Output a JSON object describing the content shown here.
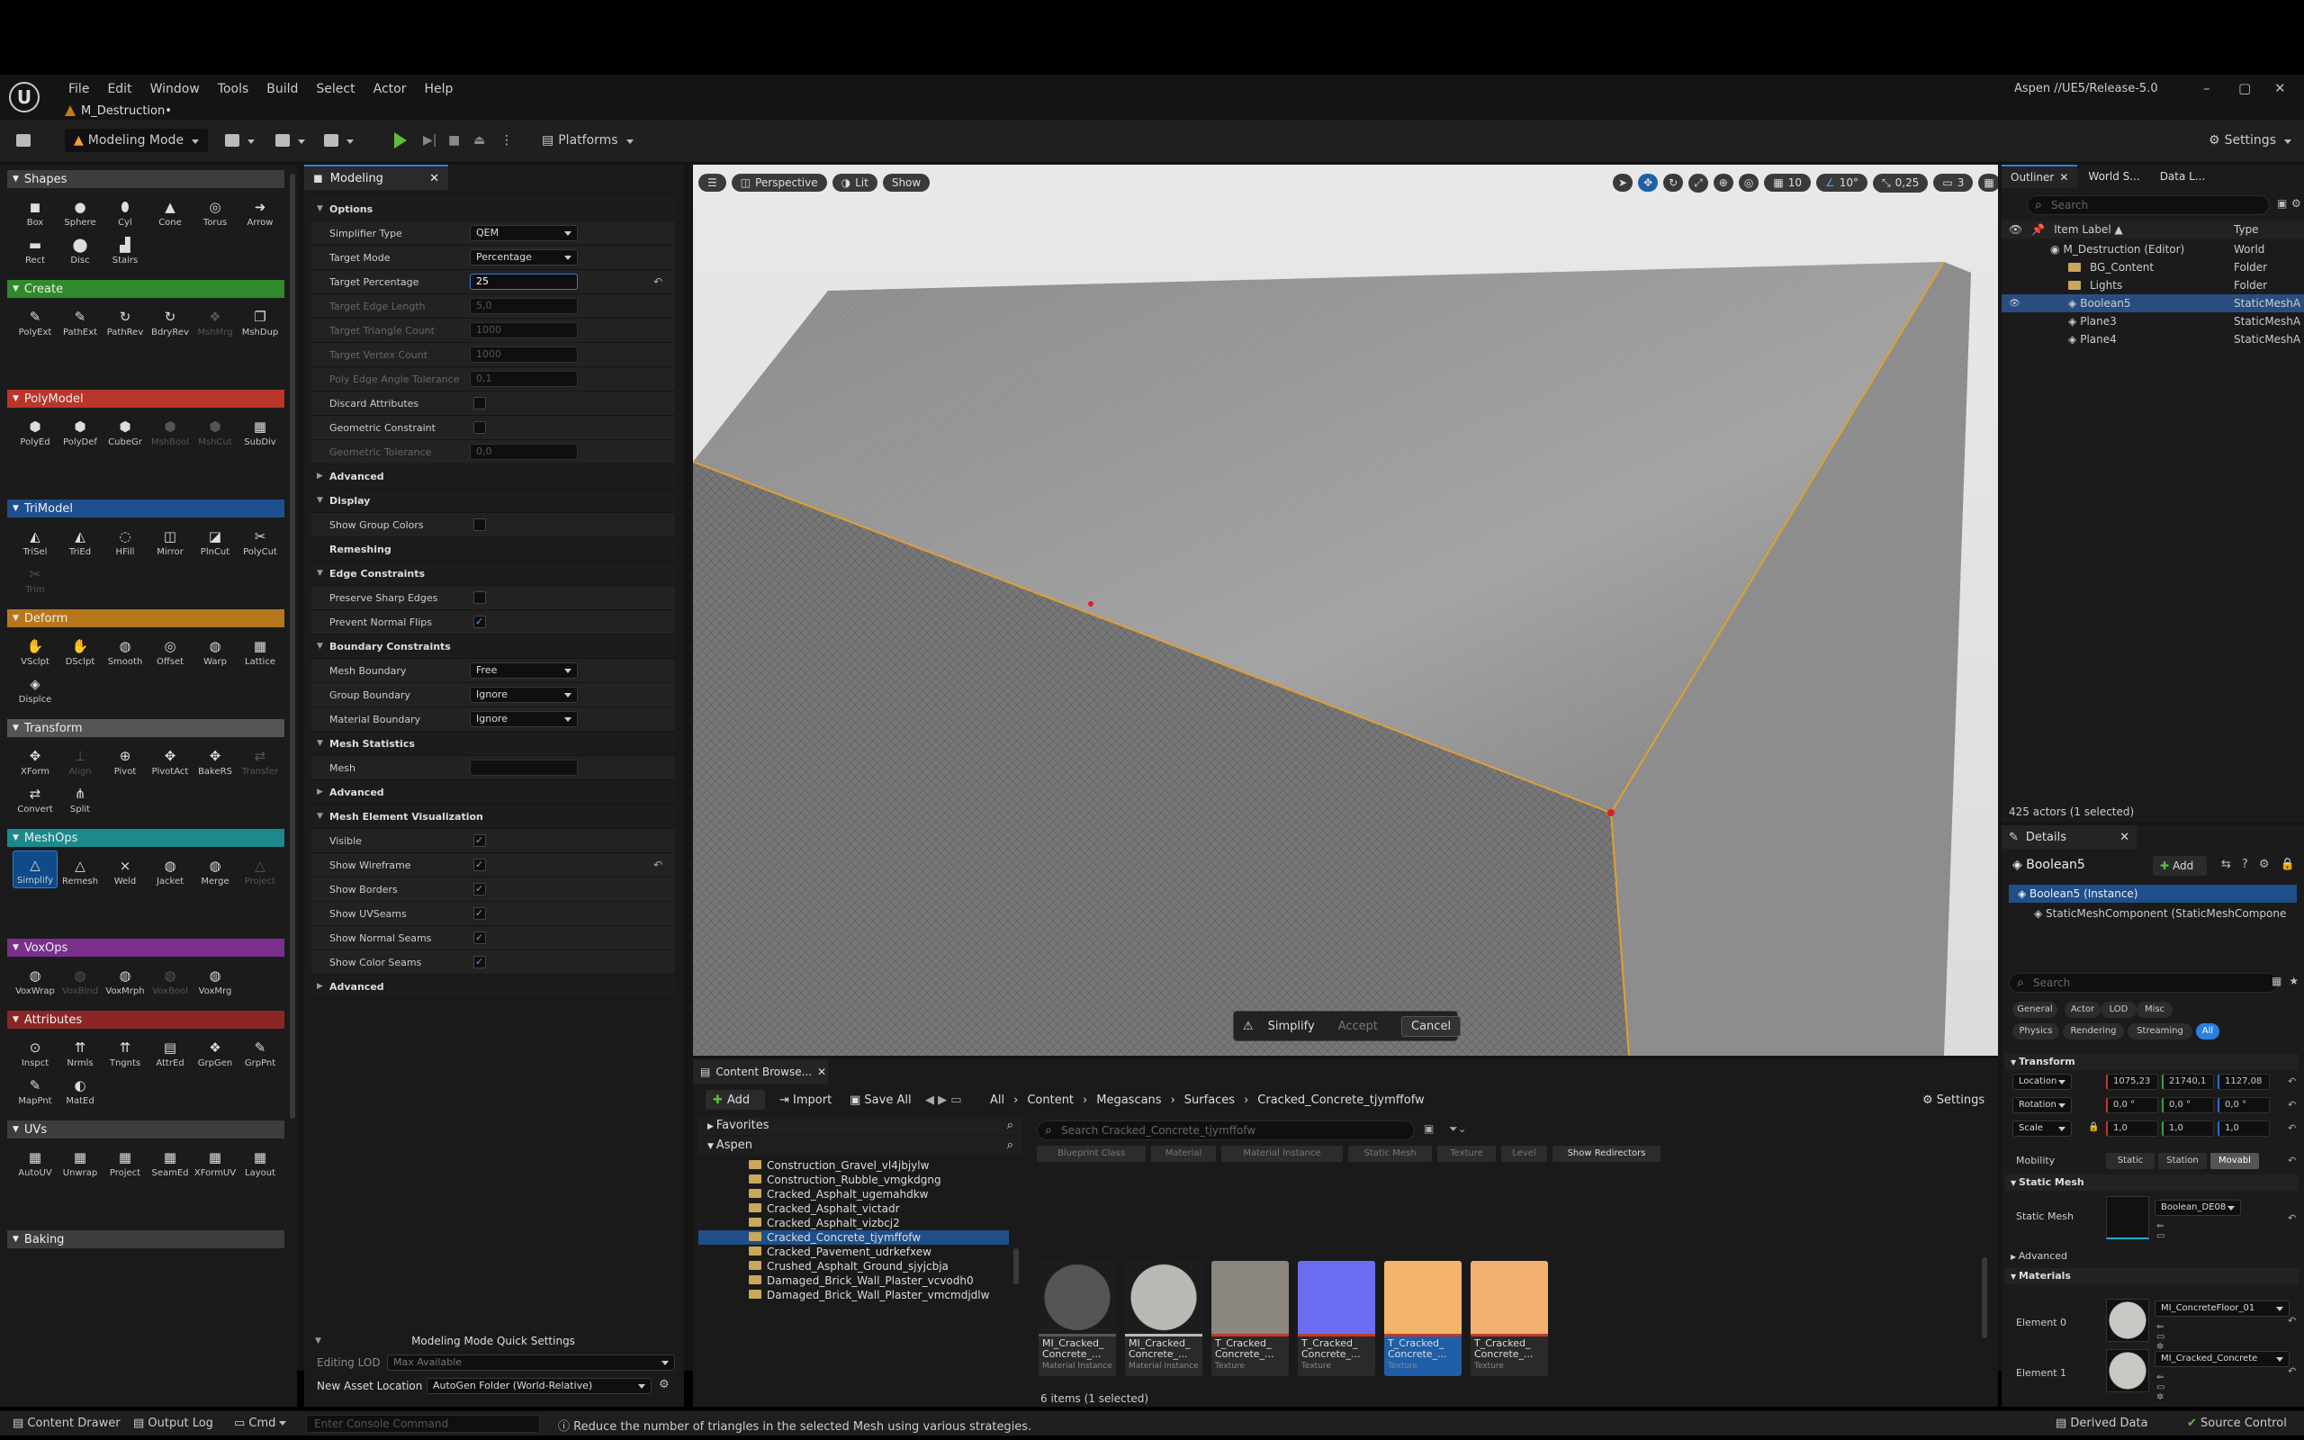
{
  "menu": [
    "File",
    "Edit",
    "Window",
    "Tools",
    "Build",
    "Select",
    "Actor",
    "Help"
  ],
  "doc_tab": "M_Destruction•",
  "project": "Aspen //UE5/Release-5.0",
  "toolbar": {
    "mode": "Modeling Mode",
    "platforms": "Platforms",
    "settings": "Settings"
  },
  "palette": {
    "sections": [
      {
        "name": "Shapes",
        "color": "#3d3d3d",
        "tools": [
          {
            "l": "Box",
            "g": "◼"
          },
          {
            "l": "Sphere",
            "g": "●"
          },
          {
            "l": "Cyl",
            "g": "⬮"
          },
          {
            "l": "Cone",
            "g": "▲"
          },
          {
            "l": "Torus",
            "g": "◎"
          },
          {
            "l": "Arrow",
            "g": "➜"
          },
          {
            "l": "Rect",
            "g": "▬"
          },
          {
            "l": "Disc",
            "g": "⬤"
          },
          {
            "l": "Stairs",
            "g": "▟"
          }
        ]
      },
      {
        "name": "Create",
        "color": "#2f8a2c",
        "tools": [
          {
            "l": "PolyExt",
            "g": "✎"
          },
          {
            "l": "PathExt",
            "g": "✎"
          },
          {
            "l": "PathRev",
            "g": "↻"
          },
          {
            "l": "BdryRev",
            "g": "↻"
          },
          {
            "l": "MshMrg",
            "g": "❖",
            "d": true
          },
          {
            "l": "MshDup",
            "g": "❐"
          }
        ]
      },
      {
        "name": "PolyModel",
        "color": "#b8362a",
        "tools": [
          {
            "l": "PolyEd",
            "g": "⬢"
          },
          {
            "l": "PolyDef",
            "g": "⬢"
          },
          {
            "l": "CubeGr",
            "g": "⬢"
          },
          {
            "l": "MshBool",
            "g": "⬢",
            "d": true
          },
          {
            "l": "MshCut",
            "g": "⬢",
            "d": true
          },
          {
            "l": "SubDiv",
            "g": "▦"
          }
        ]
      },
      {
        "name": "TriModel",
        "color": "#1e4f8f",
        "tools": [
          {
            "l": "TriSel",
            "g": "◭"
          },
          {
            "l": "TriEd",
            "g": "◭"
          },
          {
            "l": "HFill",
            "g": "◌"
          },
          {
            "l": "Mirror",
            "g": "◫"
          },
          {
            "l": "PlnCut",
            "g": "◪"
          },
          {
            "l": "PolyCut",
            "g": "✂"
          },
          {
            "l": "Trim",
            "g": "✂",
            "d": true
          }
        ]
      },
      {
        "name": "Deform",
        "color": "#b6771c",
        "tools": [
          {
            "l": "VSclpt",
            "g": "✋"
          },
          {
            "l": "DSclpt",
            "g": "✋"
          },
          {
            "l": "Smooth",
            "g": "◍"
          },
          {
            "l": "Offset",
            "g": "◎"
          },
          {
            "l": "Warp",
            "g": "◍"
          },
          {
            "l": "Lattice",
            "g": "▦"
          },
          {
            "l": "Displce",
            "g": "◈"
          }
        ]
      },
      {
        "name": "Transform",
        "color": "#555555",
        "tools": [
          {
            "l": "XForm",
            "g": "✥"
          },
          {
            "l": "Align",
            "g": "⊥",
            "d": true
          },
          {
            "l": "Pivot",
            "g": "⊕"
          },
          {
            "l": "PivotAct",
            "g": "✥"
          },
          {
            "l": "BakeRS",
            "g": "✥"
          },
          {
            "l": "Transfer",
            "g": "⇄",
            "d": true
          },
          {
            "l": "Convert",
            "g": "⇄"
          },
          {
            "l": "Split",
            "g": "⋔"
          }
        ]
      },
      {
        "name": "MeshOps",
        "color": "#1c8a8c",
        "tools": [
          {
            "l": "Simplify",
            "g": "△",
            "s": true
          },
          {
            "l": "Remesh",
            "g": "△"
          },
          {
            "l": "Weld",
            "g": "⨯"
          },
          {
            "l": "Jacket",
            "g": "◍"
          },
          {
            "l": "Merge",
            "g": "◍"
          },
          {
            "l": "Project",
            "g": "△",
            "d": true
          }
        ]
      },
      {
        "name": "VoxOps",
        "color": "#7a2f8c",
        "tools": [
          {
            "l": "VoxWrap",
            "g": "◍"
          },
          {
            "l": "VoxBlnd",
            "g": "◍",
            "d": true
          },
          {
            "l": "VoxMrph",
            "g": "◍"
          },
          {
            "l": "VoxBool",
            "g": "◍",
            "d": true
          },
          {
            "l": "VoxMrg",
            "g": "◍"
          }
        ]
      },
      {
        "name": "Attributes",
        "color": "#8c2626",
        "tools": [
          {
            "l": "Inspct",
            "g": "⊙"
          },
          {
            "l": "Nrmls",
            "g": "⇈"
          },
          {
            "l": "Tngnts",
            "g": "⇈"
          },
          {
            "l": "AttrEd",
            "g": "▤"
          },
          {
            "l": "GrpGen",
            "g": "❖"
          },
          {
            "l": "GrpPnt",
            "g": "✎"
          },
          {
            "l": "MapPnt",
            "g": "✎"
          },
          {
            "l": "MatEd",
            "g": "◐"
          }
        ]
      },
      {
        "name": "UVs",
        "color": "#3d3d3d",
        "tools": [
          {
            "l": "AutoUV",
            "g": "▦"
          },
          {
            "l": "Unwrap",
            "g": "▦"
          },
          {
            "l": "Project",
            "g": "▦"
          },
          {
            "l": "SeamEd",
            "g": "▦"
          },
          {
            "l": "XFormUV",
            "g": "▦"
          },
          {
            "l": "Layout",
            "g": "▦"
          }
        ]
      },
      {
        "name": "Baking",
        "color": "#3d3d3d",
        "tools": []
      }
    ]
  },
  "modeling": {
    "tab": "Modeling",
    "rows": [
      {
        "t": "h",
        "l": "Options"
      },
      {
        "l": "Simplifier Type",
        "dd": "QEM"
      },
      {
        "l": "Target Mode",
        "dd": "Percentage"
      },
      {
        "l": "Target Percentage",
        "v": "25",
        "hl": true,
        "r": true
      },
      {
        "l": "Target Edge Length",
        "v": "5,0",
        "d": true
      },
      {
        "l": "Target Triangle Count",
        "v": "1000",
        "d": true
      },
      {
        "l": "Target Vertex Count",
        "v": "1000",
        "d": true
      },
      {
        "l": "Poly Edge Angle Tolerance",
        "v": "0,1",
        "d": true
      },
      {
        "l": "Discard Attributes",
        "c": false
      },
      {
        "l": "Geometric Constraint",
        "c": false
      },
      {
        "l": "Geometric Tolerance",
        "v": "0,0",
        "d": true
      },
      {
        "t": "s",
        "l": "Advanced"
      },
      {
        "t": "h",
        "l": "Display"
      },
      {
        "l": "Show Group Colors",
        "c": false
      },
      {
        "t": "h",
        "l": "Remeshing",
        "notri": true
      },
      {
        "t": "h",
        "l": "Edge Constraints"
      },
      {
        "l": "Preserve Sharp Edges",
        "c": false
      },
      {
        "l": "Prevent Normal Flips",
        "c": true
      },
      {
        "t": "h",
        "l": "Boundary Constraints"
      },
      {
        "l": "Mesh Boundary",
        "dd": "Free"
      },
      {
        "l": "Group Boundary",
        "dd": "Ignore"
      },
      {
        "l": "Material Boundary",
        "dd": "Ignore"
      },
      {
        "t": "h",
        "l": "Mesh Statistics"
      },
      {
        "l": "Mesh",
        "v": ""
      },
      {
        "t": "s",
        "l": "Advanced"
      },
      {
        "t": "h",
        "l": "Mesh Element Visualization"
      },
      {
        "l": "Visible",
        "c": true
      },
      {
        "l": "Show Wireframe",
        "c": true,
        "r": true
      },
      {
        "l": "Show Borders",
        "c": true
      },
      {
        "l": "Show UVSeams",
        "c": true
      },
      {
        "l": "Show Normal Seams",
        "c": true
      },
      {
        "l": "Show Color Seams",
        "c": true
      },
      {
        "t": "s",
        "l": "Advanced"
      }
    ],
    "quick": {
      "title": "Modeling Mode Quick Settings",
      "lod_label": "Editing LOD",
      "lod": "Max Available",
      "loc_label": "New Asset Location",
      "loc": "AutoGen Folder (World-Relative)"
    }
  },
  "viewport": {
    "perspective": "Perspective",
    "lit": "Lit",
    "show": "Show",
    "grid": "10",
    "angle": "10°",
    "scale": "0,25",
    "cam": "3",
    "simplify": "Simplify",
    "accept": "Accept",
    "cancel": "Cancel"
  },
  "content": {
    "tab": "Content Browse...",
    "add": "Add",
    "import": "Import",
    "save_all": "Save All",
    "settings": "Settings",
    "path": [
      "All",
      "Content",
      "Megascans",
      "Surfaces",
      "Cracked_Concrete_tjymffofw"
    ],
    "favorites": "Favorites",
    "aspen": "Aspen",
    "folders": [
      "Construction_Gravel_vl4jbjylw",
      "Construction_Rubble_vmgkdgng",
      "Cracked_Asphalt_ugemahdkw",
      "Cracked_Asphalt_victadr",
      "Cracked_Asphalt_vizbcj2",
      "Cracked_Concrete_tjymffofw",
      "Cracked_Pavement_udrkefxew",
      "Crushed_Asphalt_Ground_sjyjcbja",
      "Damaged_Brick_Wall_Plaster_vcvodh0",
      "Damaged_Brick_Wall_Plaster_vmcmdjdlw"
    ],
    "search_ph": "Search Cracked_Concrete_tjymffofw",
    "filters": [
      "Blueprint Class",
      "Material",
      "Material Instance",
      "Static Mesh",
      "Texture",
      "Level"
    ],
    "redirectors": "Show Redirectors",
    "assets": [
      {
        "n": "MI_Cracked_ Concrete_...",
        "t": "Material Instance",
        "bg": "#2a2a2a",
        "c": "#555"
      },
      {
        "n": "MI_Cracked_ Concrete_...",
        "t": "Material Instance",
        "bg": "#9a9a9a",
        "c": "#b9b9b5"
      },
      {
        "n": "T_Cracked_ Concrete_...",
        "t": "Texture",
        "bg": "#8c8680",
        "c": "#c0392b"
      },
      {
        "n": "T_Cracked_ Concrete_...",
        "t": "Texture",
        "bg": "#6c6cf0",
        "c": "#c0392b"
      },
      {
        "n": "T_Cracked_ Concrete_...",
        "t": "Texture",
        "bg": "#f2b56a",
        "c": "#c0392b",
        "s": true
      },
      {
        "n": "T_Cracked_ Concrete_...",
        "t": "Texture",
        "bg": "#f2b070",
        "c": "#c0392b"
      }
    ],
    "count": "6 items (1 selected)"
  },
  "outliner": {
    "tabs": [
      "Outliner",
      "World S...",
      "Data L..."
    ],
    "search": "Search",
    "col1": "Item Label ▲",
    "col2": "Type",
    "rows": [
      {
        "n": "M_Destruction (Editor)",
        "t": "World",
        "ind": 0,
        "ic": "world"
      },
      {
        "n": "BG_Content",
        "t": "Folder",
        "ind": 1,
        "ic": "folder"
      },
      {
        "n": "Lights",
        "t": "Folder",
        "ind": 1,
        "ic": "folder"
      },
      {
        "n": "Boolean5",
        "t": "StaticMeshA",
        "ind": 1,
        "ic": "mesh",
        "s": true
      },
      {
        "n": "Plane3",
        "t": "StaticMeshA",
        "ind": 1,
        "ic": "mesh"
      },
      {
        "n": "Plane4",
        "t": "StaticMeshA",
        "ind": 1,
        "ic": "mesh"
      }
    ],
    "footer": "425 actors (1 selected)"
  },
  "details": {
    "tab": "Details",
    "name": "Boolean5",
    "add": "Add",
    "instance": "Boolean5 (Instance)",
    "component": "StaticMeshComponent (StaticMeshCompone",
    "search": "Search",
    "filters": [
      "General",
      "Actor",
      "LOD",
      "Misc",
      "Physics",
      "Rendering",
      "Streaming",
      "All"
    ],
    "transform": "Transform",
    "location": "Location",
    "rotation": "Rotation",
    "scale": "Scale",
    "loc": [
      "1075,23",
      "21740,1",
      "1127,08"
    ],
    "rot": [
      "0,0 °",
      "0,0 °",
      "0,0 °"
    ],
    "scl": [
      "1,0",
      "1,0",
      "1,0"
    ],
    "mobility": "Mobility",
    "mob": [
      "Static",
      "Station",
      "Movabl"
    ],
    "static_mesh_sec": "Static Mesh",
    "static_mesh": "Static Mesh",
    "mesh_name": "Boolean_DE08",
    "advanced": "Advanced",
    "materials": "Materials",
    "el0": "Element 0",
    "el1": "Element 1",
    "mat0": "MI_ConcreteFloor_01",
    "mat1": "MI_Cracked_Concrete"
  },
  "status": {
    "drawer": "Content Drawer",
    "log": "Output Log",
    "cmd": "Cmd",
    "console_ph": "Enter Console Command",
    "hint": "Reduce the number of triangles in the selected Mesh using various strategies.",
    "derived": "Derived Data",
    "source": "Source Control"
  }
}
